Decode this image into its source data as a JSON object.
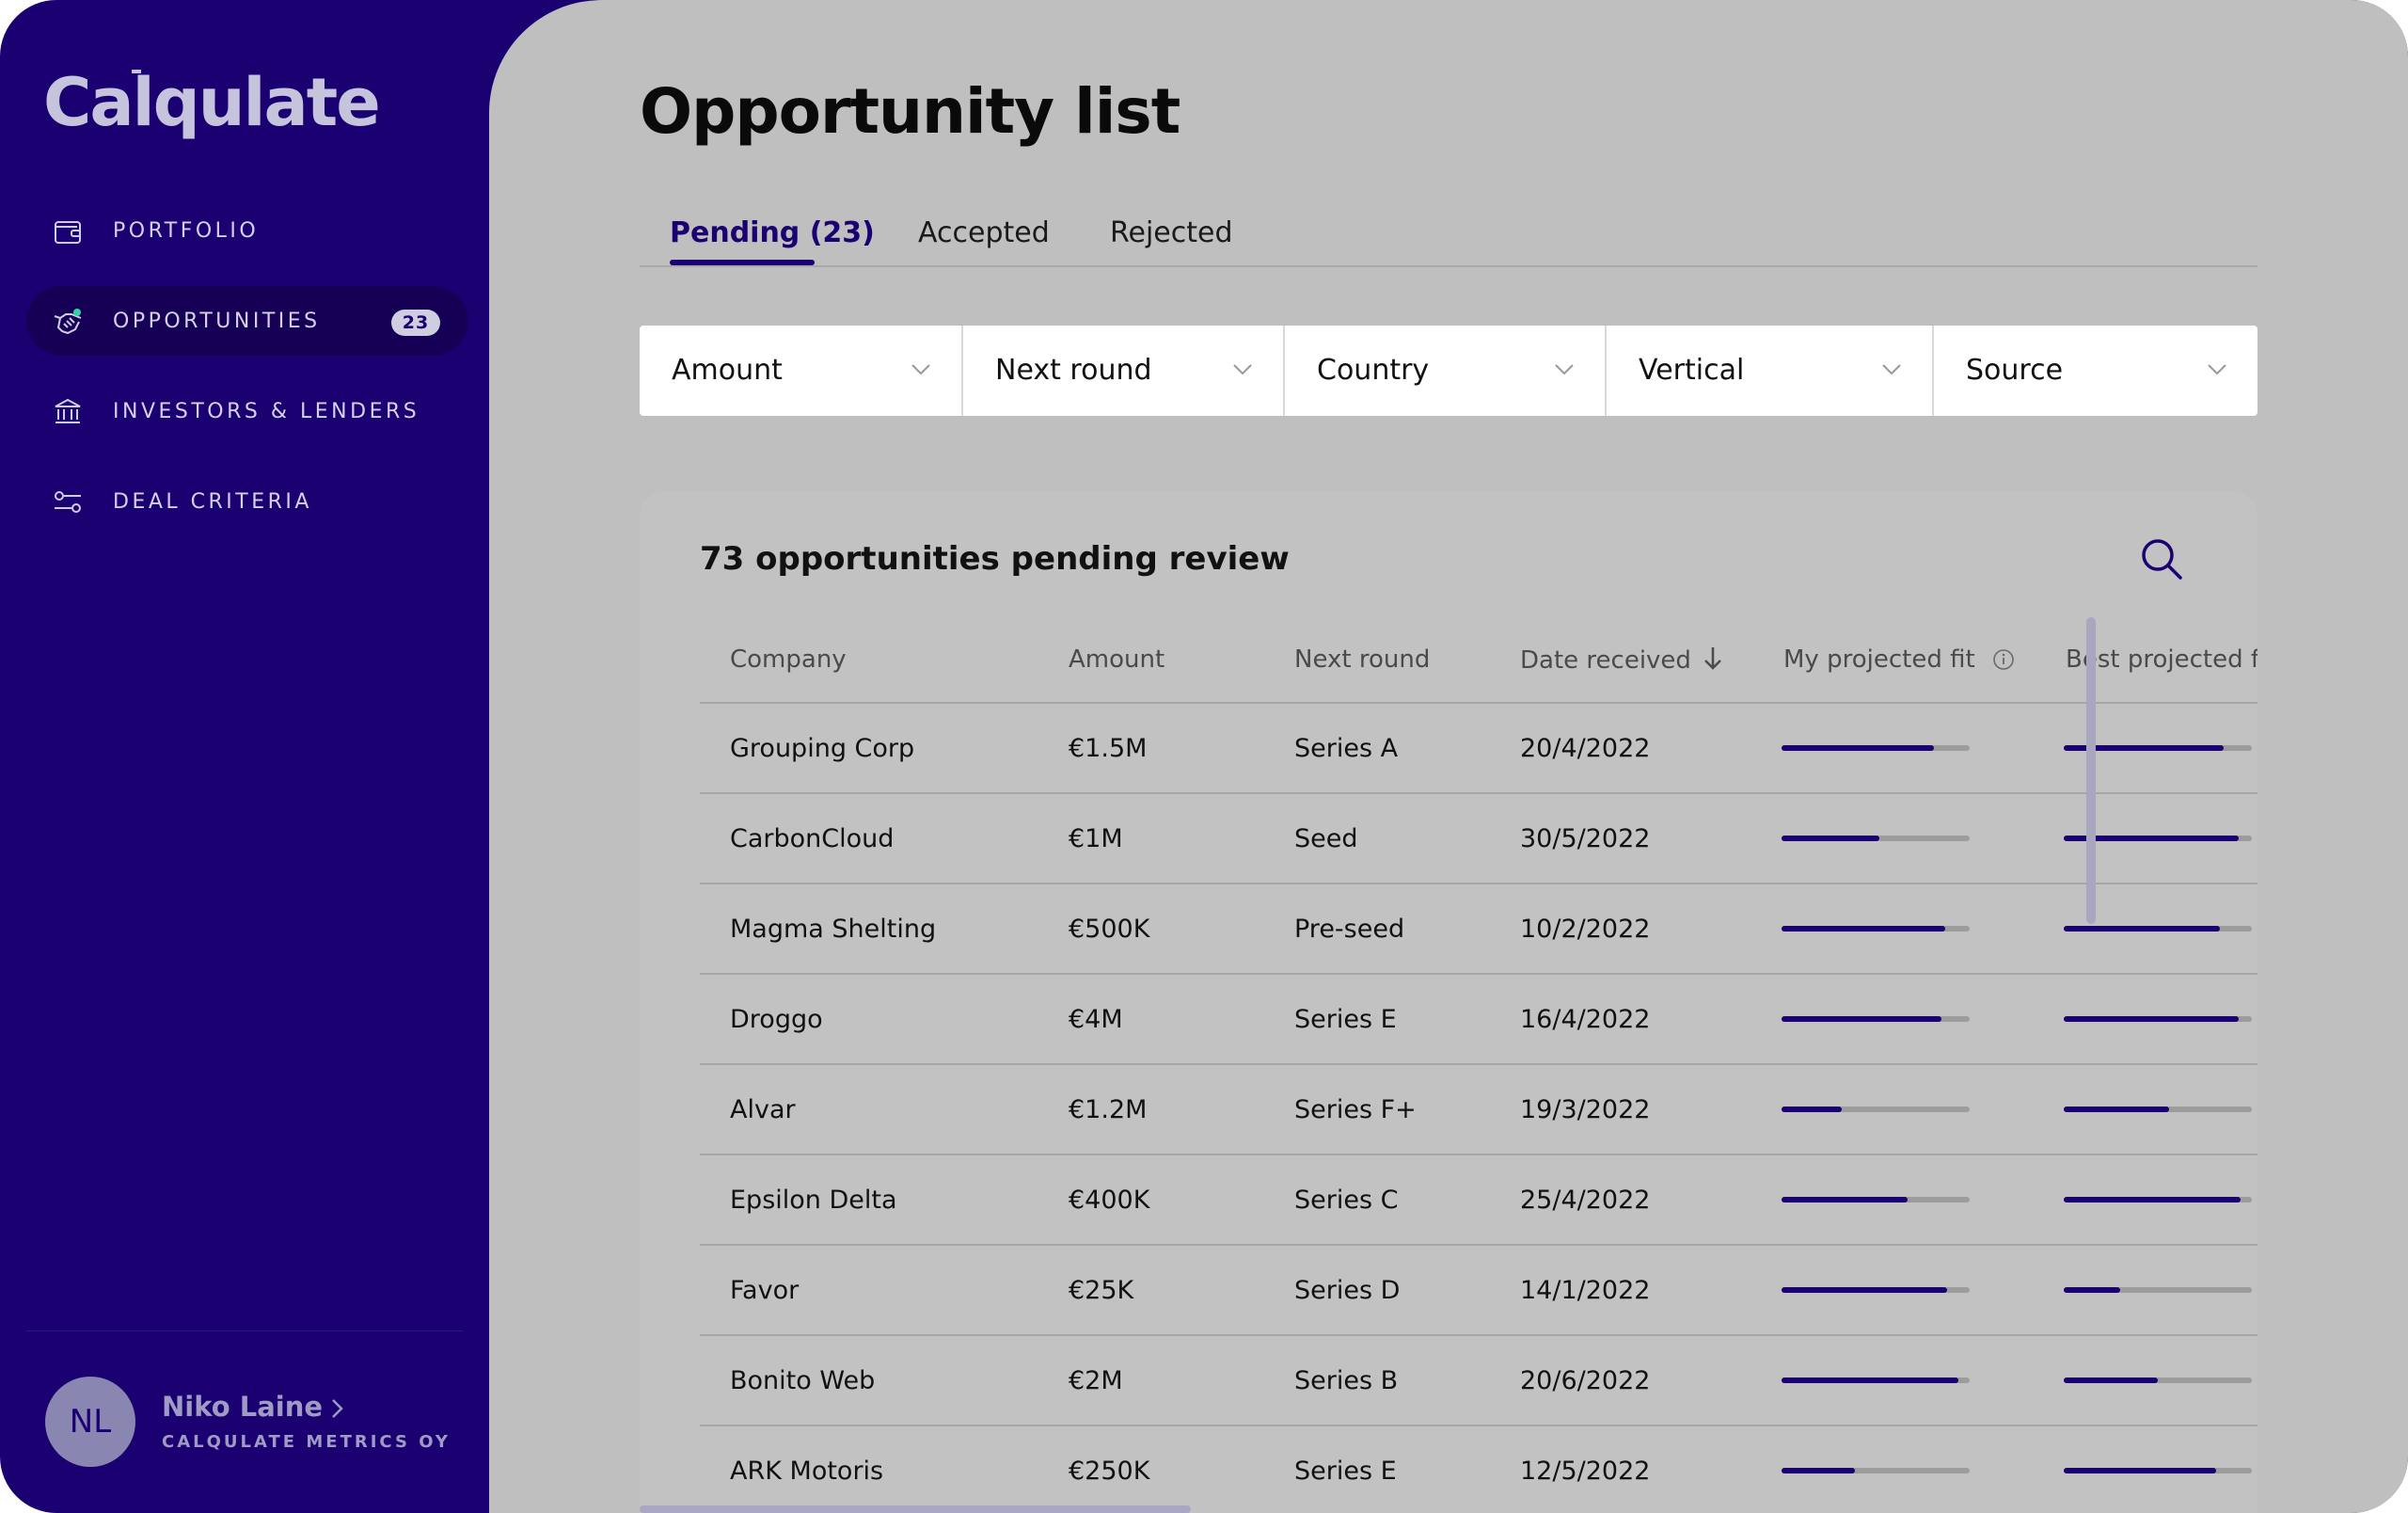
{
  "app": {
    "logo": "Calqulate"
  },
  "sidebar": {
    "items": [
      {
        "label": "PORTFOLIO",
        "icon": "wallet-icon",
        "active": false,
        "badge": ""
      },
      {
        "label": "OPPORTUNITIES",
        "icon": "handshake-icon",
        "active": true,
        "badge": "23"
      },
      {
        "label": "INVESTORS & LENDERS",
        "icon": "bank-icon",
        "active": false,
        "badge": ""
      },
      {
        "label": "DEAL CRITERIA",
        "icon": "sliders-icon",
        "active": false,
        "badge": ""
      }
    ],
    "user": {
      "initials": "NL",
      "name": "Niko Laine",
      "org": "CALQULATE METRICS OY"
    }
  },
  "main": {
    "title": "Opportunity list",
    "tabs": [
      {
        "label": "Pending (23)",
        "active": true
      },
      {
        "label": "Accepted",
        "active": false
      },
      {
        "label": "Rejected",
        "active": false
      }
    ],
    "filters": [
      "Amount",
      "Next round",
      "Country",
      "Vertical",
      "Source"
    ],
    "card_title": "73 opportunities pending review",
    "columns": [
      "Company",
      "Amount",
      "Next round",
      "Date received",
      "My projected fit",
      "Best projected fit"
    ],
    "rows": [
      {
        "company": "Grouping Corp",
        "amount": "€1.5M",
        "round": "Series A",
        "date": "20/4/2022",
        "my_fit": 0.81,
        "best_fit": 0.85
      },
      {
        "company": "CarbonCloud",
        "amount": "€1M",
        "round": "Seed",
        "date": "30/5/2022",
        "my_fit": 0.52,
        "best_fit": 0.93
      },
      {
        "company": "Magma Shelting",
        "amount": "€500K",
        "round": "Pre-seed",
        "date": "10/2/2022",
        "my_fit": 0.87,
        "best_fit": 0.83
      },
      {
        "company": "Droggo",
        "amount": "€4M",
        "round": "Series E",
        "date": "16/4/2022",
        "my_fit": 0.85,
        "best_fit": 0.93
      },
      {
        "company": "Alvar",
        "amount": "€1.2M",
        "round": "Series F+",
        "date": "19/3/2022",
        "my_fit": 0.32,
        "best_fit": 0.56
      },
      {
        "company": "Epsilon Delta",
        "amount": "€400K",
        "round": "Series C",
        "date": "25/4/2022",
        "my_fit": 0.67,
        "best_fit": 0.94
      },
      {
        "company": "Favor",
        "amount": "€25K",
        "round": "Series D",
        "date": "14/1/2022",
        "my_fit": 0.88,
        "best_fit": 0.3
      },
      {
        "company": "Bonito Web",
        "amount": "€2M",
        "round": "Series B",
        "date": "20/6/2022",
        "my_fit": 0.94,
        "best_fit": 0.5
      },
      {
        "company": "ARK Motoris",
        "amount": "€250K",
        "round": "Series E",
        "date": "12/5/2022",
        "my_fit": 0.39,
        "best_fit": 0.81
      }
    ]
  },
  "colors": {
    "sidebar_bg": "#1b0072",
    "main_bg": "#bfbfbf",
    "accent": "#1b0072"
  }
}
